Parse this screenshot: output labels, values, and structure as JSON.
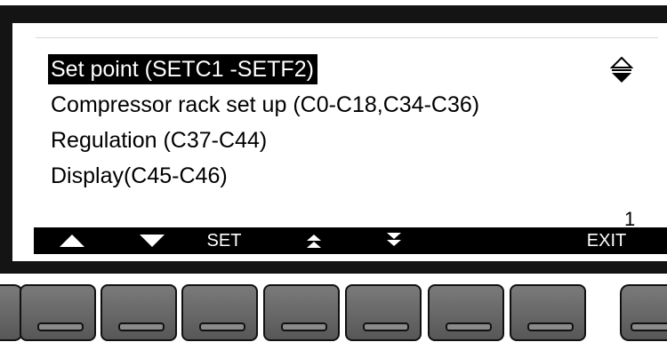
{
  "menu": {
    "items": [
      {
        "label": "Set point (SETC1 -SETF2)",
        "selected": true
      },
      {
        "label": "Compressor rack set up (C0-C18,C34-C36)",
        "selected": false
      },
      {
        "label": "Regulation (C37-C44)",
        "selected": false
      },
      {
        "label": "Display(C45-C46)",
        "selected": false
      }
    ],
    "scroll_indicator_icon": "up-down-arrows-icon",
    "page_number": "1"
  },
  "softkeys": [
    {
      "icon": "triangle-up-icon",
      "label": ""
    },
    {
      "icon": "triangle-down-icon",
      "label": ""
    },
    {
      "icon": "",
      "label": "SET"
    },
    {
      "icon": "double-chevron-up-icon",
      "label": ""
    },
    {
      "icon": "double-chevron-down-icon",
      "label": ""
    },
    {
      "icon": "",
      "label": ""
    },
    {
      "icon": "",
      "label": ""
    },
    {
      "icon": "",
      "label": "EXIT"
    }
  ],
  "colors": {
    "bezel": "#141414",
    "screen_bg": "#ffffff",
    "text": "#000000",
    "selection_bg": "#000000",
    "selection_text": "#ffffff",
    "softkey_bar": "#000000",
    "button_face": "#6a6a6a"
  }
}
